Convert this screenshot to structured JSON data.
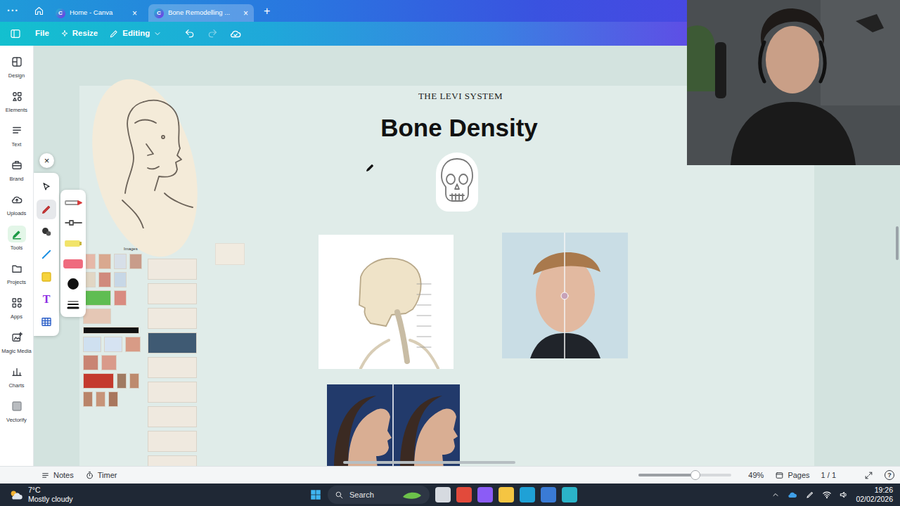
{
  "browser": {
    "menu": "···",
    "tabs": [
      {
        "logo": "C",
        "label": "Home - Canva",
        "close": "×",
        "selected": false
      },
      {
        "logo": "C",
        "label": "Bone Remodelling ...",
        "close": "×",
        "selected": true
      }
    ],
    "new_tab": "+"
  },
  "editor_bar": {
    "file": "File",
    "resize": "Resize",
    "editing": "Editing",
    "redo_disabled": true
  },
  "sidebar": {
    "items": [
      {
        "label": "Design",
        "selected": false
      },
      {
        "label": "Elements",
        "selected": false
      },
      {
        "label": "Text",
        "selected": false
      },
      {
        "label": "Brand",
        "selected": false
      },
      {
        "label": "Uploads",
        "selected": false
      },
      {
        "label": "Tools",
        "selected": true
      },
      {
        "label": "Projects",
        "selected": false
      },
      {
        "label": "Apps",
        "selected": false
      },
      {
        "label": "Magic Media",
        "selected": false
      },
      {
        "label": "Charts",
        "selected": false
      },
      {
        "label": "Vectorify",
        "selected": false
      }
    ]
  },
  "canvas": {
    "brand": "THE LEVI SYSTEM",
    "title": "Bone Density",
    "images_label": "Images"
  },
  "draw_tools": {
    "close": "×",
    "tools": [
      {
        "kind": "select",
        "selected": false
      },
      {
        "kind": "pen",
        "selected": true
      },
      {
        "kind": "shape",
        "selected": false
      },
      {
        "kind": "line",
        "selected": false
      },
      {
        "kind": "sticky",
        "selected": false
      },
      {
        "kind": "text",
        "label": "T",
        "selected": false
      },
      {
        "kind": "table",
        "selected": false
      }
    ],
    "pens": [
      {
        "kind": "marker",
        "color": "#d63a3a"
      },
      {
        "kind": "pen",
        "color": "#222222"
      },
      {
        "kind": "highlighter",
        "color": "#f2e46a"
      },
      {
        "kind": "eraser",
        "color": "#ef6b7e"
      },
      {
        "kind": "dot",
        "color": "#111111"
      },
      {
        "kind": "weight",
        "color": "#111111"
      }
    ]
  },
  "footer": {
    "notes": "Notes",
    "timer": "Timer",
    "zoom": "49%",
    "zoom_level": 0.61,
    "pages": "Pages",
    "page_count": "1 / 1",
    "help": "?"
  },
  "taskbar": {
    "temperature": "7°C",
    "weather": "Mostly cloudy",
    "search": "Search",
    "time": "19:26",
    "date": "02/02/2026"
  }
}
